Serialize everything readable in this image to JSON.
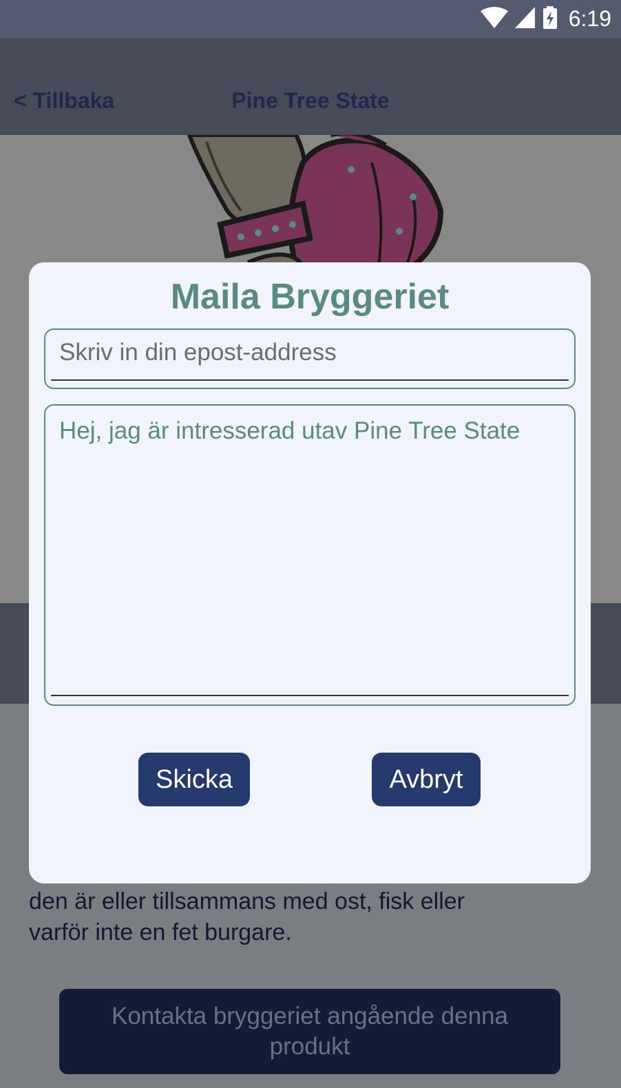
{
  "status_bar": {
    "time": "6:19"
  },
  "nav": {
    "back_label": "< Tillbaka",
    "title": "Pine Tree State"
  },
  "page": {
    "description_lines": [
      "den är eller tillsammans med ost, fisk eller",
      "varför inte en fet burgare."
    ],
    "contact_button": "Kontakta bryggeriet angående denna produkt"
  },
  "dialog": {
    "title": "Maila Bryggeriet",
    "email_placeholder": "Skriv in din epost-address",
    "message_text": "Hej, jag är intresserad utav Pine Tree State",
    "send_label": "Skicka",
    "cancel_label": "Avbryt"
  }
}
